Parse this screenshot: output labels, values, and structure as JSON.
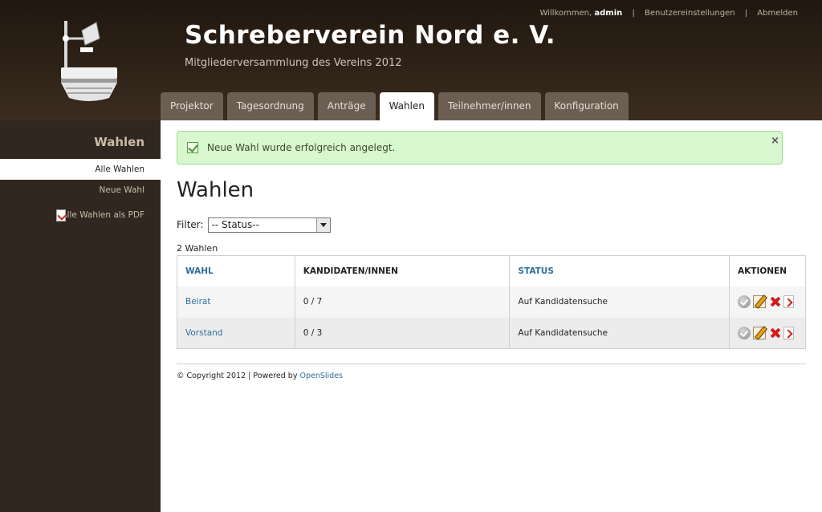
{
  "header": {
    "title": "Schreberverein Nord e. V.",
    "subtitle": "Mitgliederversammlung des Vereins 2012",
    "welcome_prefix": "Willkommen,",
    "username": "admin",
    "settings_link": "Benutzereinstellungen",
    "logout_link": "Abmelden",
    "separator": "|",
    "logo_icon": "overhead-projector-icon"
  },
  "tabs": [
    {
      "label": "Projektor",
      "active": false
    },
    {
      "label": "Tagesordnung",
      "active": false
    },
    {
      "label": "Anträge",
      "active": false
    },
    {
      "label": "Wahlen",
      "active": true
    },
    {
      "label": "Teilnehmer/innen",
      "active": false
    },
    {
      "label": "Konfiguration",
      "active": false
    }
  ],
  "sidebar": {
    "title": "Wahlen",
    "items": [
      {
        "label": "Alle Wahlen",
        "active": true
      },
      {
        "label": "Neue Wahl",
        "active": false
      },
      {
        "label": "Alle Wahlen als PDF",
        "active": false,
        "icon": "pdf-icon"
      }
    ]
  },
  "alert": {
    "message": "Neue Wahl wurde erfolgreich angelegt.",
    "close": "×",
    "icon": "success-check-icon"
  },
  "main": {
    "title": "Wahlen",
    "filter_label": "Filter:",
    "filter_selected": "-- Status--",
    "count_text": "2 Wahlen"
  },
  "table": {
    "headers": [
      "WAHL",
      "KANDIDATEN/INNEN",
      "STATUS",
      "AKTIONEN"
    ],
    "rows": [
      {
        "name": "Beirat",
        "candidates": "0 / 7",
        "status": "Auf Kandidatensuche"
      },
      {
        "name": "Vorstand",
        "candidates": "0 / 3",
        "status": "Auf Kandidatensuche"
      }
    ],
    "action_icons": [
      "activate-check-icon",
      "edit-pencil-icon",
      "delete-x-icon",
      "pdf-icon"
    ]
  },
  "footer": {
    "text": "© Copyright 2012 | Powered by",
    "link": "OpenSlides"
  },
  "colors": {
    "header_bg": "#2b2118",
    "sidebar_bg": "#302720",
    "tab_bg": "#6b5f53",
    "link": "#2f6f9a",
    "alert_bg": "#d7f7cf"
  }
}
